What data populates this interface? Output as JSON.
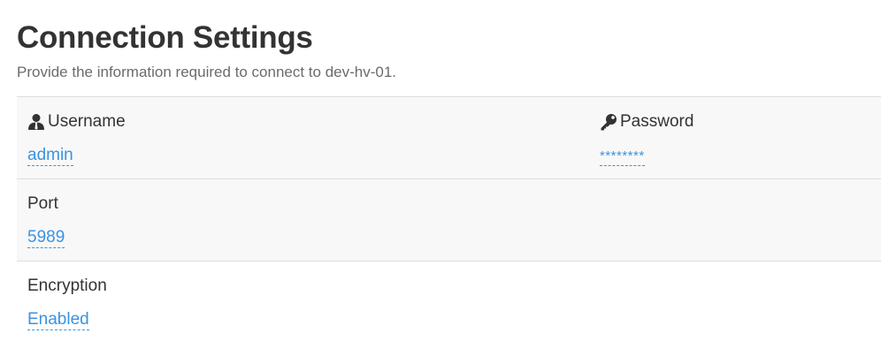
{
  "header": {
    "title": "Connection Settings",
    "subtitle": "Provide the information required to connect to dev-hv-01."
  },
  "fields": {
    "username": {
      "label": "Username",
      "value": "admin",
      "icon": "user-icon"
    },
    "password": {
      "label": "Password",
      "value": "********",
      "icon": "key-icon"
    },
    "port": {
      "label": "Port",
      "value": "5989"
    },
    "encryption": {
      "label": "Encryption",
      "value": "Enabled"
    }
  },
  "colors": {
    "link": "#3a93e0",
    "row_shade": "#f8f8f8",
    "border": "#dddddd",
    "text": "#333333"
  }
}
